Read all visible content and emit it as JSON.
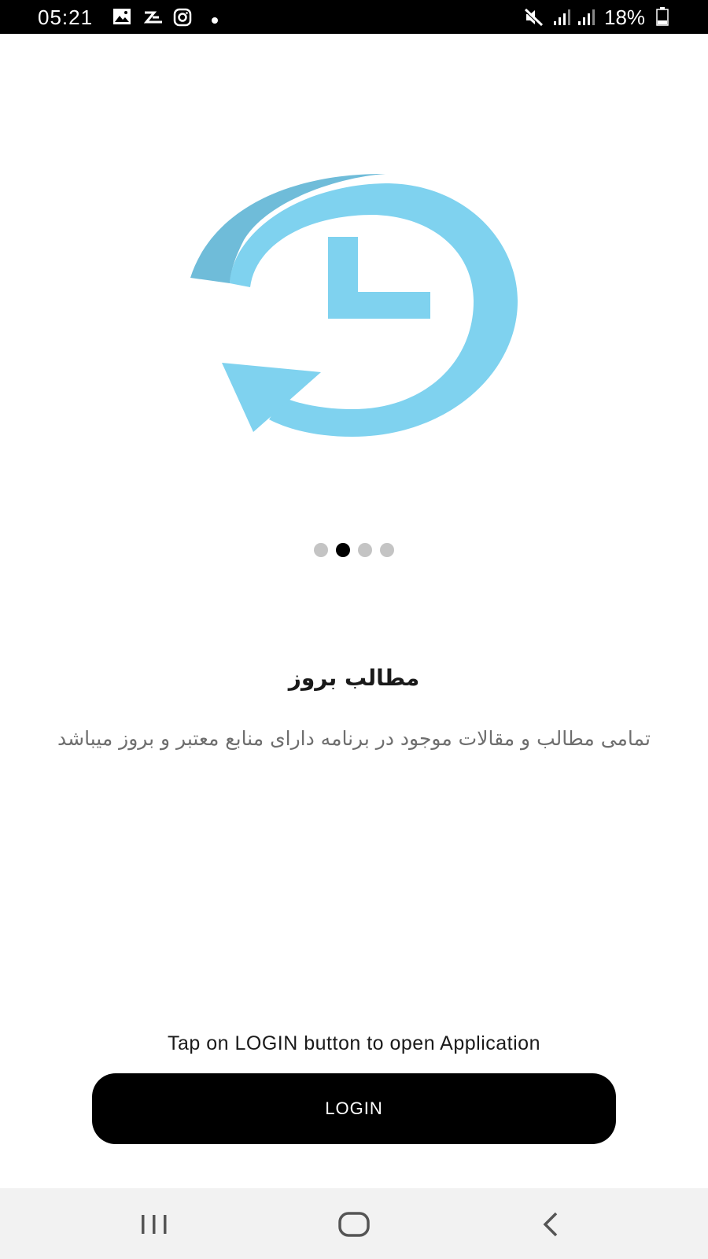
{
  "status_bar": {
    "time": "05:21",
    "battery_percent": "18%",
    "left_icons": [
      "gallery-icon",
      "flash-app-icon",
      "instagram-icon",
      "notification-dot-icon"
    ],
    "right_icons": [
      "mute-icon",
      "signal-icon",
      "signal-icon",
      "battery-icon"
    ]
  },
  "onboarding": {
    "illustration_icon": "clock-refresh-icon",
    "accent_color": "#7fd2ef",
    "shade_color": "#6fbcd9",
    "page_count": 4,
    "active_page": 2,
    "title": "مطالب بروز",
    "description": "تمامی مطالب و مقالات موجود در برنامه دارای منابع معتبر و بروز میباشد"
  },
  "footer": {
    "hint": "Tap on LOGIN button to open Application",
    "login_label": "LOGIN"
  },
  "nav_bar": {
    "items": [
      "recent-apps-icon",
      "home-icon",
      "back-icon"
    ]
  }
}
